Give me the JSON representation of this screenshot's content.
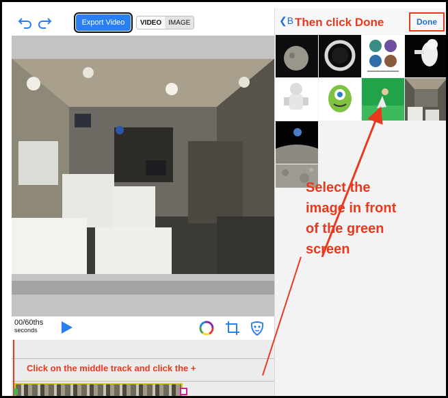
{
  "toolbar": {
    "undo_icon": "undo-icon",
    "redo_icon": "redo-icon",
    "export_label": "Export Video",
    "mode_video": "VIDEO",
    "mode_image": "IMAGE",
    "selected_mode": "VIDEO"
  },
  "controls": {
    "time_value": "00/60ths",
    "time_unit": "seconds",
    "icons": [
      "play-icon",
      "color-wheel-icon",
      "crop-icon",
      "mask-icon"
    ]
  },
  "timeline": {
    "caption": "Click on the middle track and click the +"
  },
  "picker": {
    "back_label": "B",
    "done_label": "Done",
    "thumbnails": [
      "moon-thumbnail",
      "helmet-thumbnail",
      "diagram-thumbnail",
      "astronaut-thumbnail",
      "astronaut-white-thumbnail",
      "green-monster-thumbnail",
      "green-screen-person-thumbnail",
      "space-station-thumbnail",
      "earth-rise-thumbnail",
      "lunar-surface-thumbnail"
    ]
  },
  "annotations": {
    "top": "Then click Done",
    "middle": [
      "Select the",
      "image in front",
      "of the green",
      "screen"
    ]
  },
  "colors": {
    "accent_blue": "#2a7ff0",
    "annotation_red": "#e8391e",
    "clip_border": "#d8d200"
  }
}
